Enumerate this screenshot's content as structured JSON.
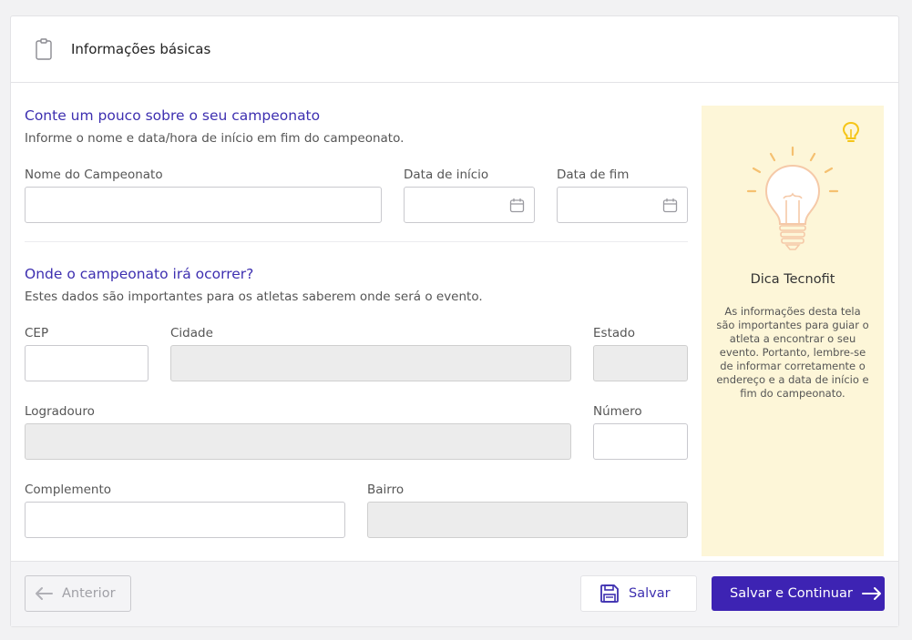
{
  "header": {
    "title": "Informações básicas"
  },
  "section1": {
    "title": "Conte um pouco sobre o seu campeonato",
    "description": "Informe o nome e data/hora de início em fim do campeonato.",
    "fields": {
      "name_label": "Nome do Campeonato",
      "start_label": "Data de início",
      "end_label": "Data de fim"
    }
  },
  "section2": {
    "title": "Onde o campeonato irá ocorrer?",
    "description": "Estes dados são importantes para os atletas saberem onde será o evento.",
    "fields": {
      "cep_label": "CEP",
      "city_label": "Cidade",
      "state_label": "Estado",
      "street_label": "Logradouro",
      "number_label": "Número",
      "complement_label": "Complemento",
      "district_label": "Bairro"
    }
  },
  "tip": {
    "title": "Dica Tecnofit",
    "text": "As informações desta tela são importantes para guiar o atleta  a encontrar o seu evento. Portanto, lembre-se de informar corretamente o endereço e a data de início e fim do campeonato."
  },
  "footer": {
    "prev_label": "Anterior",
    "save_label": "Salvar",
    "continue_label": "Salvar e Continuar"
  },
  "colors": {
    "accent": "#3d23b3",
    "tip_bg": "#fdf6d8",
    "bulb": "#f5c518"
  },
  "icons": [
    "clipboard-icon",
    "calendar-icon",
    "lightbulb-icon",
    "arrow-left-icon",
    "floppy-icon",
    "arrow-right-icon"
  ]
}
